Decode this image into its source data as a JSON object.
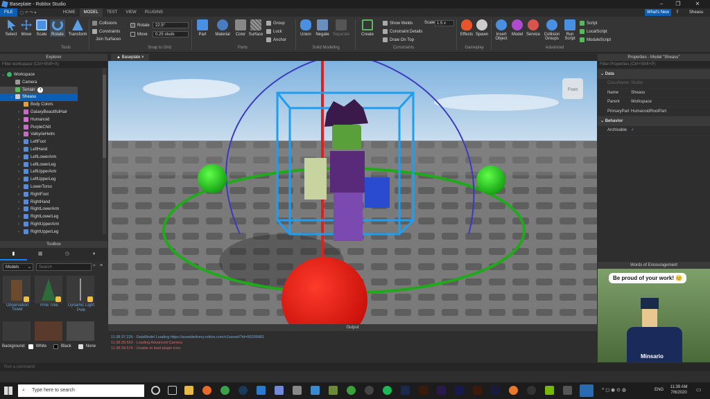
{
  "titlebar": {
    "title": "Baseplate - Roblox Studio"
  },
  "menubar": {
    "file": "FILE",
    "tabs": [
      "HOME",
      "MODEL",
      "TEST",
      "VIEW",
      "PLUGINS"
    ],
    "whats_new": "What's New",
    "user": "Sheasu"
  },
  "ribbon": {
    "tools": [
      "Select",
      "Move",
      "Scale",
      "Rotate",
      "Transform"
    ],
    "tools_group": "Tools",
    "collisions": "Collisions",
    "constraints": "Constraints",
    "join_surfaces": "Join Surfaces",
    "rotate_label": "Rotate",
    "rotate_value": "22.5°",
    "move_label": "Move",
    "move_value": "0.25 studs",
    "snap_group": "Snap to Grid",
    "parts": [
      "Part",
      "Material",
      "Color",
      "Surface"
    ],
    "group": "Group",
    "lock": "Lock",
    "anchor": "Anchor",
    "parts_group": "Parts",
    "solid": [
      "Union",
      "Negate",
      "Separate"
    ],
    "solid_group": "Solid Modeling",
    "create": "Create",
    "show_welds": "Show Welds",
    "constraint_details": "Constraint Details",
    "draw_on_top": "Draw On Top",
    "scale_label": "Scale",
    "scale_value": "1.5 x",
    "constraints_group": "Constraints",
    "gameplay": [
      "Effects",
      "Spawn"
    ],
    "gameplay_group": "Gameplay",
    "advanced": [
      "Insert Object",
      "Model",
      "Service",
      "Collision Groups",
      "Run Script"
    ],
    "scripts": [
      "Script",
      "LocalScript",
      "ModuleScript"
    ],
    "advanced_group": "Advanced"
  },
  "explorer": {
    "title": "Explorer",
    "filter": "Filter workspace (Ctrl+Shift+X)",
    "items": [
      "Workspace",
      "Camera",
      "Terrain",
      "Sheasu",
      "Body Colors",
      "GalaxyBeautifulHair",
      "Humanoid",
      "PurpleChill",
      "ValkyrieHelm",
      "LeftFoot",
      "LeftHand",
      "LeftLowerArm",
      "LeftLowerLeg",
      "LeftUpperArm",
      "LeftUpperLeg",
      "LowerTorso",
      "RightFoot",
      "RightHand",
      "RightLowerArm",
      "RightLowerLeg",
      "RightUpperArm",
      "RightUpperLeg"
    ]
  },
  "toolbox": {
    "title": "Toolbox",
    "category": "Models",
    "search_placeholder": "Search",
    "items": [
      "Observation Tower",
      "Pine Tree",
      "Dynamic Light Pole"
    ],
    "background_label": "Background:",
    "bg_options": [
      "White",
      "Black",
      "None"
    ]
  },
  "viewport": {
    "tab": "Baseplate",
    "view_cube": "Front"
  },
  "output": {
    "title": "Output",
    "lines": [
      {
        "text": "11:38:37.226 - DataModel Loading https://assetdelivery.roblox.com/v1/asset/?id=95206881",
        "color": "#6fa8dc"
      },
      {
        "text": "11:38:39.563 - Loading Advanced Camera",
        "color": "#e06666"
      },
      {
        "text": "11:38:39.574 - Unable to load plugin icon.",
        "color": "#e06666"
      }
    ]
  },
  "properties": {
    "title": "Properties - Model \"Sheasu\"",
    "filter": "Filter Properties (Ctrl+Shift+P)",
    "data_section": "Data",
    "tab_classname": "ClassName",
    "tab_studio": "Studio",
    "rows": [
      {
        "key": "Name",
        "value": "Sheasu"
      },
      {
        "key": "Parent",
        "value": "Workspace"
      },
      {
        "key": "PrimaryPart",
        "value": "HumanoidRootPart"
      }
    ],
    "behavior_section": "Behavior",
    "archivable": "Archivable",
    "archivable_value": "✓"
  },
  "words": {
    "title": "Words of Encouragement",
    "message": "Be proud of your work! 😊",
    "name": "Minsario"
  },
  "command_bar": {
    "placeholder": "Run a command"
  },
  "taskbar": {
    "search_placeholder": "Type here to search",
    "time": "11:39 AM",
    "date": "7/6/2020",
    "lang": "ENG"
  },
  "colors": {
    "accent": "#0078d7",
    "selection": "#0a5fb4"
  }
}
